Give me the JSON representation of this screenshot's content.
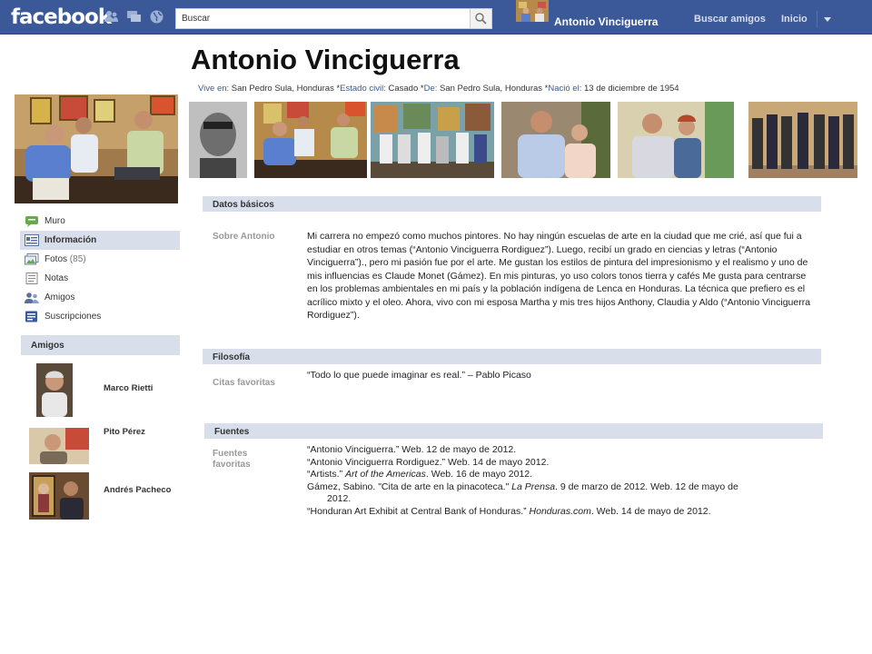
{
  "topbar": {
    "logo": "facebook",
    "search_placeholder": "Buscar",
    "user_name": "Antonio Vinciguerra",
    "find_friends": "Buscar amigos",
    "home": "Inicio"
  },
  "profile": {
    "name": "Antonio Vinciguerra",
    "lives_label": "Vive en:",
    "lives_value": "San Pedro Sula, Honduras *",
    "status_label": "Estado civil:",
    "status_value": "Casado *",
    "from_label": "De:",
    "from_value": "San Pedro Sula, Honduras *",
    "born_label": "Nació el:",
    "born_value": "13  de diciembre de 1954"
  },
  "nav": [
    {
      "label": "Muro"
    },
    {
      "label": "Información"
    },
    {
      "label": "Fotos",
      "count": "(85)"
    },
    {
      "label": "Notas"
    },
    {
      "label": "Amigos"
    },
    {
      "label": "Suscripciones"
    }
  ],
  "friends": {
    "title": "Amigos",
    "items": [
      "Marco Rietti",
      "Pito Pérez",
      "Andrés Pacheco"
    ]
  },
  "basic": {
    "title": "Datos básicos",
    "about_label": "Sobre Antonio",
    "about_text": "Mi carrera no empezó como muchos pintores. No hay ningún escuelas de arte en la ciudad que me crié, así que fui a estudiar en otros temas (“Antonio Vinciguerra Rordiguez”). Luego, recibí un grado en ciencias y letras (“Antonio Vinciguerra”)., pero mi pasión fue por el arte. Me gustan los estilos de pintura del impresionismo y el realismo y uno de mis influencias es Claude Monet (Gámez).  En mis pinturas,  yo uso colors tonos tierra y cafés Me gusta para centrarse en los problemas ambientales en mi país y la población indígena de Lenca en Honduras. La técnica que prefiero es el acrílico mixto y el oleo. Ahora, vivo con mi esposa Martha y mis tres hijos Anthony, Claudia y Aldo (“Antonio Vinciguerra Rordiguez”)."
  },
  "philosophy": {
    "title": "Filosofía",
    "quotes_label": "Citas favoritas",
    "quote": "“Todo lo que puede imaginar es real.” – Pablo Picaso"
  },
  "sources": {
    "title": "Fuentes",
    "label": "Fuentes favoritas",
    "s1": "“Antonio Vinciguerra.” Web. 12 de mayo de 2012.",
    "s2": "“Antonio Vinciguerra Rordiguez.” Web. 14 de mayo 2012.",
    "s3a": "“Artists.” ",
    "s3b": "Art of the Americas",
    "s3c": ". Web. 16 de mayo 2012.",
    "s4a": "Gámez, Sabino. \"Cita de arte en la pinacoteca.\" ",
    "s4b": "La Prensa",
    "s4c": ". 9 de marzo de 2012.  Web.  12  de mayo de",
    "s4d": "2012.",
    "s5a": "“Honduran Art Exhibit at Central Bank of Honduras.” ",
    "s5b": "Honduras.com",
    "s5c": ". Web. 14 de mayo de 2012."
  },
  "colors": {
    "brand": "#3b5998",
    "section_bg": "#d8dfea",
    "link": "#3b5998"
  }
}
